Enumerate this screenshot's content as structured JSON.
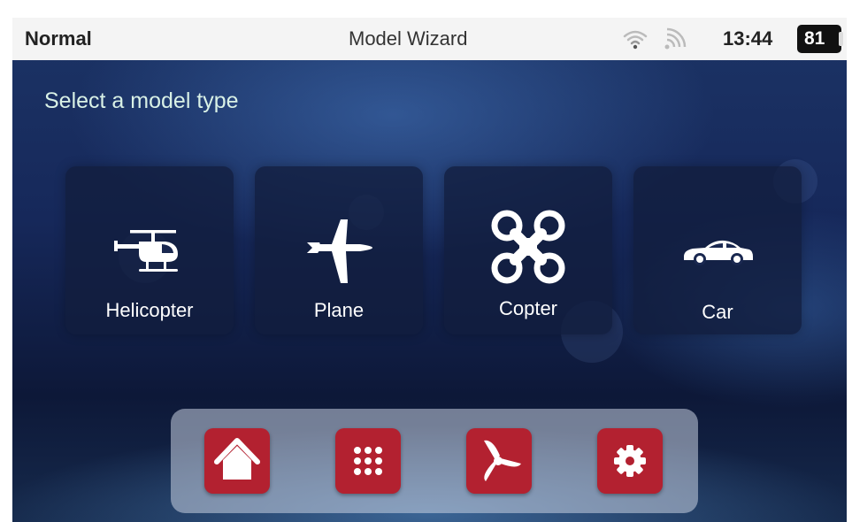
{
  "status_bar": {
    "mode": "Normal",
    "title": "Model Wizard",
    "time": "13:44",
    "battery": "81",
    "icons": [
      "wifi-icon",
      "signal-icon",
      "battery-icon"
    ]
  },
  "heading": "Select a model type",
  "model_types": [
    {
      "label": "Helicopter",
      "icon": "helicopter-icon"
    },
    {
      "label": "Plane",
      "icon": "plane-icon"
    },
    {
      "label": "Copter",
      "icon": "quadcopter-icon"
    },
    {
      "label": "Car",
      "icon": "car-icon"
    }
  ],
  "dock": {
    "buttons": [
      {
        "icon": "home-icon"
      },
      {
        "icon": "apps-grid-icon"
      },
      {
        "icon": "fan-icon"
      },
      {
        "icon": "settings-gear-icon"
      }
    ]
  },
  "colors": {
    "accent": "#b32130",
    "heading_text": "#d9f1e6",
    "background": "#16285a",
    "status_bar": "#f4f4f4"
  }
}
